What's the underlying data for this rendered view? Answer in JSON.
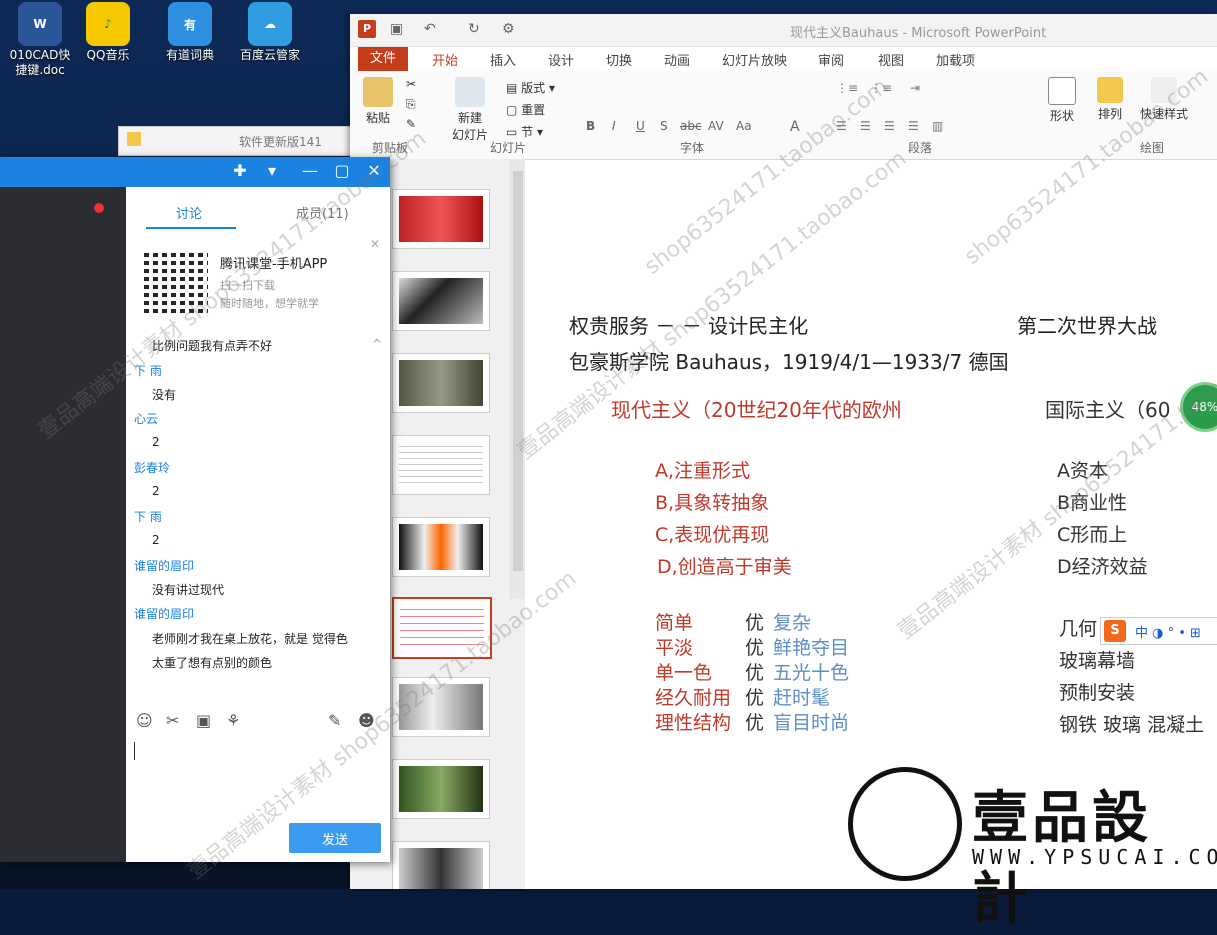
{
  "desktop": {
    "icons": [
      {
        "label": "010CAD快\n捷键.doc",
        "glyph": "W",
        "color": "#2b579a"
      },
      {
        "label": "QQ音乐",
        "glyph": "♪",
        "color": "#f7c700"
      },
      {
        "label": "有道词典",
        "glyph": "有",
        "color": "#2f8fe0"
      },
      {
        "label": "百度云管家",
        "glyph": "☁",
        "color": "#2f9de0"
      }
    ],
    "explorer_hint": "软件更新版141"
  },
  "powerpoint": {
    "window_title": "现代主义Bauhaus - Microsoft PowerPoint",
    "tabs": [
      "文件",
      "开始",
      "插入",
      "设计",
      "切换",
      "动画",
      "幻灯片放映",
      "审阅",
      "视图",
      "加载项"
    ],
    "active_tab": "开始",
    "ribbon": {
      "paste": "粘贴",
      "new_slide": "新建\n幻灯片",
      "layout": "版式",
      "reset": "重置",
      "section": "节",
      "shape": "形状",
      "arrange": "排列",
      "quick_style": "快速样式",
      "groups": [
        "剪贴板",
        "幻灯片",
        "字体",
        "段落",
        "绘图"
      ],
      "font_tools": [
        "B",
        "I",
        "U",
        "S",
        "abc",
        "AV",
        "Aa",
        "A"
      ]
    },
    "slide": {
      "line1_left": "权贵服务 － － 设计民主化",
      "line1_right": "第二次世界大战",
      "line2": "包豪斯学院 Bauhaus，1919/4/1—1933/7   德国",
      "modernism": "现代主义（20世纪20年代的欧州",
      "international": "国际主义（60",
      "left_points": [
        "A,注重形式",
        "B,具象转抽象",
        "C,表现优再现",
        "D,创造高于审美"
      ],
      "right_points": [
        "A资本",
        "B商业性",
        "C形而上",
        "D经济效益"
      ],
      "compare": [
        {
          "left": "简单",
          "right": "复杂"
        },
        {
          "left": "平淡",
          "right": "鲜艳夺目"
        },
        {
          "left": "单一色",
          "right": "五光十色"
        },
        {
          "left": "经久耐用",
          "right": "赶时髦"
        },
        {
          "left": "理性结构",
          "right": "盲目时尚"
        }
      ],
      "better": "优",
      "right_list": [
        "几何",
        "玻璃幕墙",
        "预制安装",
        "钢铁 玻璃 混凝土"
      ]
    }
  },
  "chat": {
    "tabs": [
      "讨论",
      "成员(11)"
    ],
    "promo": {
      "title": "腾讯课堂-手机APP",
      "sub1": "扫一扫下载",
      "sub2": "随时随地，想学就学"
    },
    "messages": [
      {
        "type": "text",
        "text": "比例问题我有点弄不好"
      },
      {
        "type": "name",
        "text": "下 雨"
      },
      {
        "type": "text",
        "text": "没有"
      },
      {
        "type": "name",
        "text": "心云"
      },
      {
        "type": "text",
        "text": "2"
      },
      {
        "type": "name",
        "text": "彭春玲"
      },
      {
        "type": "text",
        "text": "2"
      },
      {
        "type": "name",
        "text": "下 雨"
      },
      {
        "type": "text",
        "text": "2"
      },
      {
        "type": "name",
        "text": "谁留的眉印"
      },
      {
        "type": "text",
        "text": "没有讲过现代"
      },
      {
        "type": "name",
        "text": "谁留的眉印"
      },
      {
        "type": "text",
        "text": "老师刚才我在桌上放花，就是 觉得色"
      },
      {
        "type": "text",
        "text": "太重了想有点别的颜色"
      }
    ],
    "send": "发送"
  },
  "overlay": {
    "progress": "48%",
    "ime": "中 ◑ ° • ⊞",
    "logo_cn": "壹品設計",
    "logo_url": "WWW.YPSUCAI.COM",
    "watermarks": [
      "壹品高端设计素材 shop63524171.taobao.com",
      "shop63524171.taobao.com"
    ]
  },
  "colors": {
    "accent_red": "#c0392b",
    "accent_blue": "#5b8fc6",
    "chat_blue": "#1a82e0",
    "ppt_orange": "#c43e1c"
  }
}
